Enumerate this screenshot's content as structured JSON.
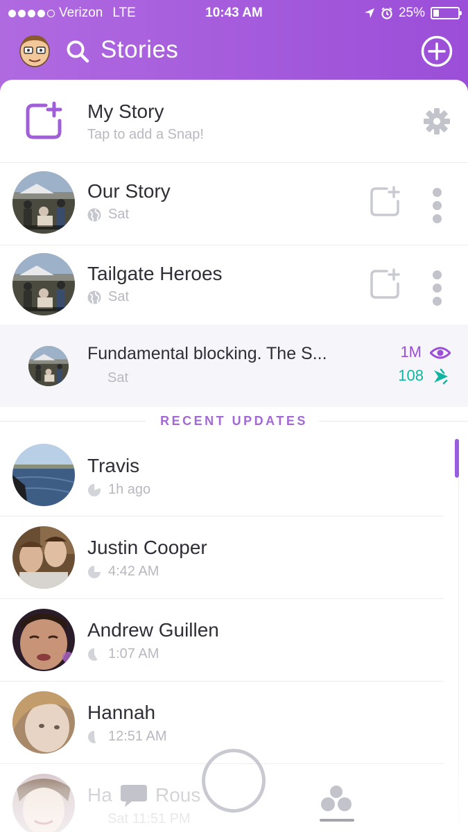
{
  "status_bar": {
    "carrier": "Verizon",
    "network": "LTE",
    "time": "10:43 AM",
    "battery": "25%",
    "battery_level": 0.25
  },
  "header": {
    "title": "Stories"
  },
  "my_story": {
    "title": "My Story",
    "subtitle": "Tap to add a Snap!"
  },
  "group_stories": [
    {
      "name": "Our Story",
      "time": "Sat"
    },
    {
      "name": "Tailgate Heroes",
      "time": "Sat"
    }
  ],
  "story_snap": {
    "caption": "Fundamental blocking. The S...",
    "time": "Sat",
    "views": "1M",
    "screenshots": "108"
  },
  "section": {
    "recent_updates_label": "RECENT UPDATES"
  },
  "recent_updates": [
    {
      "name": "Travis",
      "time": "1h ago"
    },
    {
      "name": "Justin Cooper",
      "time": "4:42 AM"
    },
    {
      "name": "Andrew Guillen",
      "time": "1:07 AM"
    },
    {
      "name": "Hannah",
      "time": "12:51 AM"
    },
    {
      "name": "Ha",
      "name_tail": "Rous",
      "time": "Sat 11:51 PM"
    }
  ],
  "colors": {
    "accent": "#9b4ed8",
    "views": "#9b4ed8",
    "screenshots": "#10b5a1",
    "muted": "#b7b8c0"
  }
}
